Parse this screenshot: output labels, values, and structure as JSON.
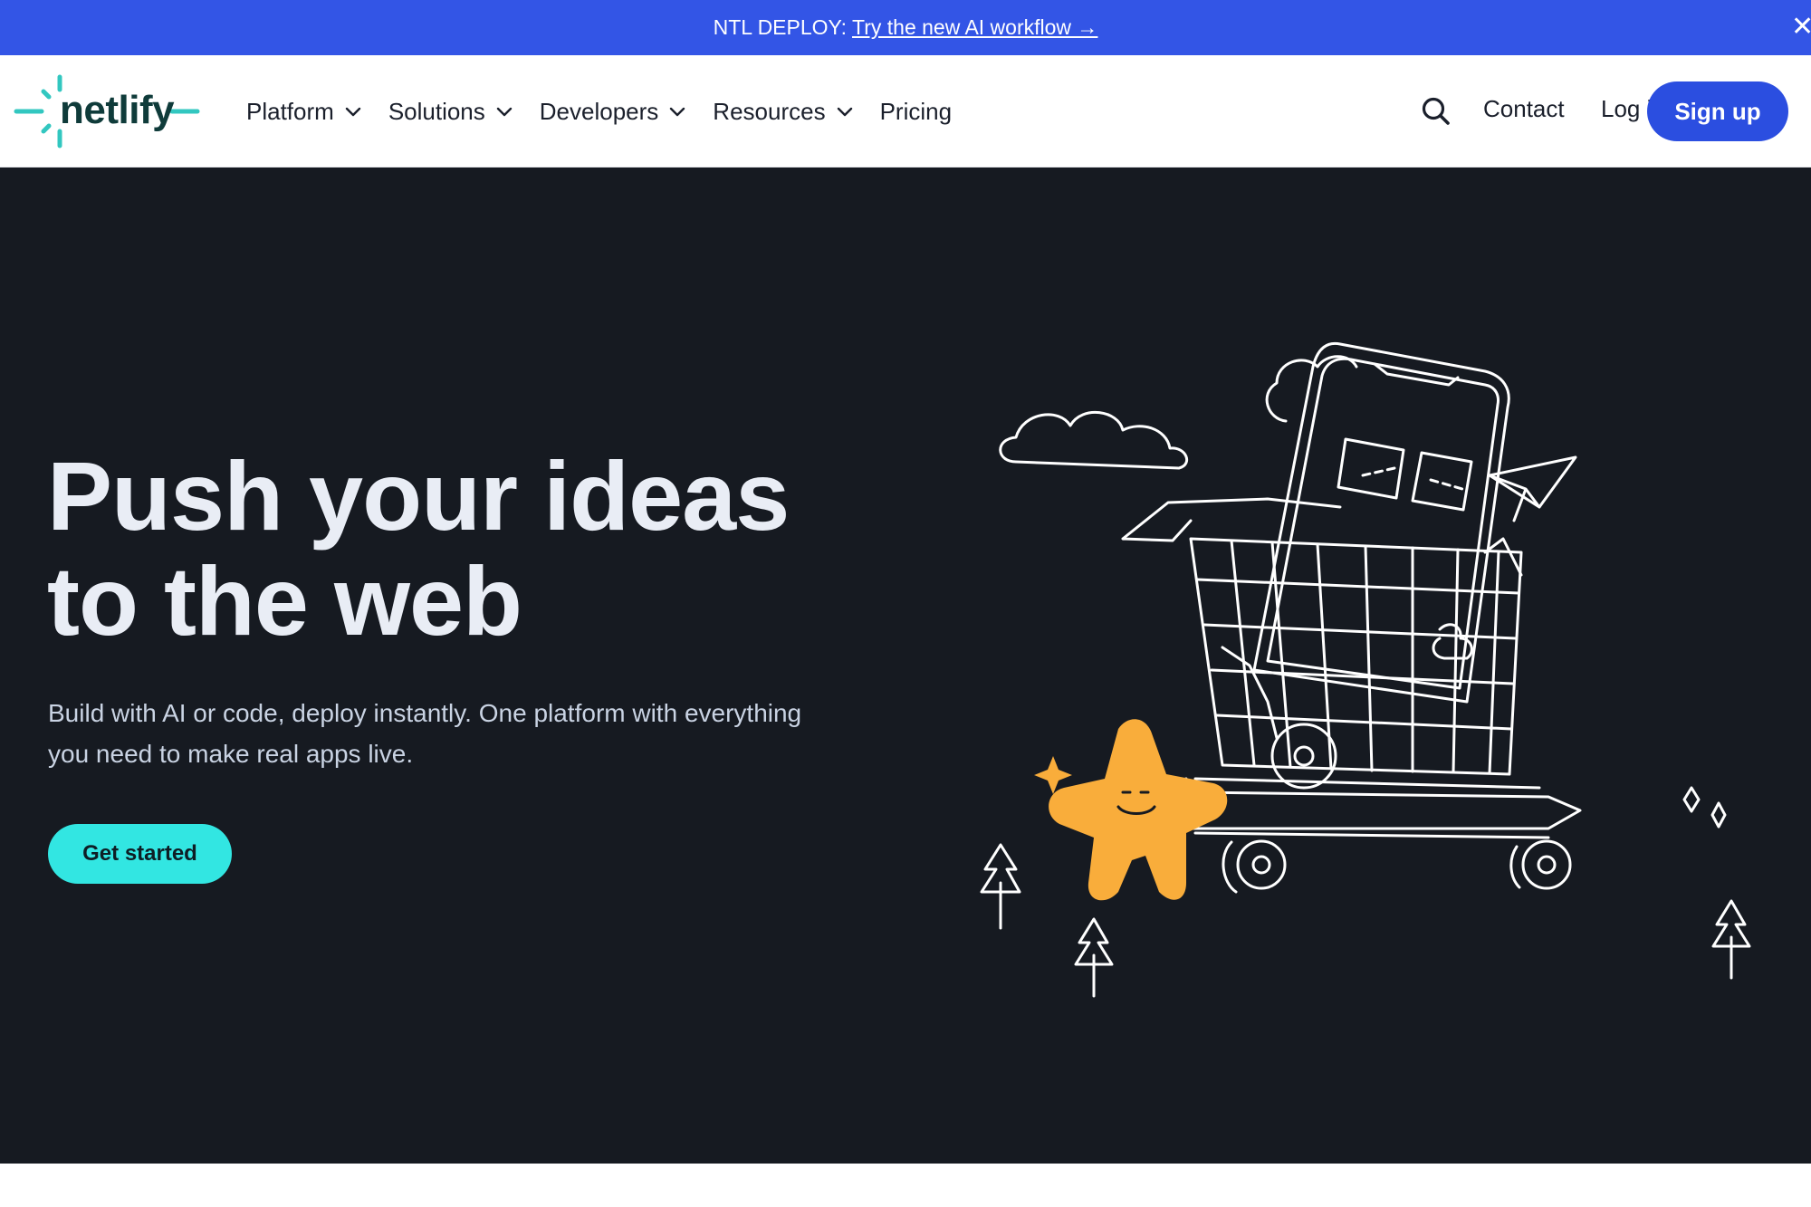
{
  "announcement": {
    "prefix": "NTL DEPLOY:",
    "link_text": "Try the new AI workflow →",
    "close_glyph": "✕"
  },
  "header": {
    "logo_text": "netlify",
    "nav": [
      {
        "label": "Platform",
        "has_dropdown": true
      },
      {
        "label": "Solutions",
        "has_dropdown": true
      },
      {
        "label": "Developers",
        "has_dropdown": true
      },
      {
        "label": "Resources",
        "has_dropdown": true
      },
      {
        "label": "Pricing",
        "has_dropdown": false
      }
    ],
    "contact_label": "Contact",
    "login_label": "Log in",
    "signup_label": "Sign up"
  },
  "hero": {
    "title_line1": "Push your ideas",
    "title_line2": "to the web",
    "subtitle_line1": "Build with AI or code, deploy instantly. One platform with everything",
    "subtitle_line2": "you need to make real apps live.",
    "cta_label": "Get started"
  },
  "colors": {
    "announcement_bg": "#3355e6",
    "signup_bg": "#2b4ee0",
    "hero_bg": "#161a21",
    "cta_bg": "#32e6e2",
    "logo_teal": "#32c7c0",
    "mascot_orange": "#f9ad3b"
  },
  "icons": {
    "search": "search-icon",
    "chevron": "chevron-down-icon",
    "close": "close-icon"
  }
}
